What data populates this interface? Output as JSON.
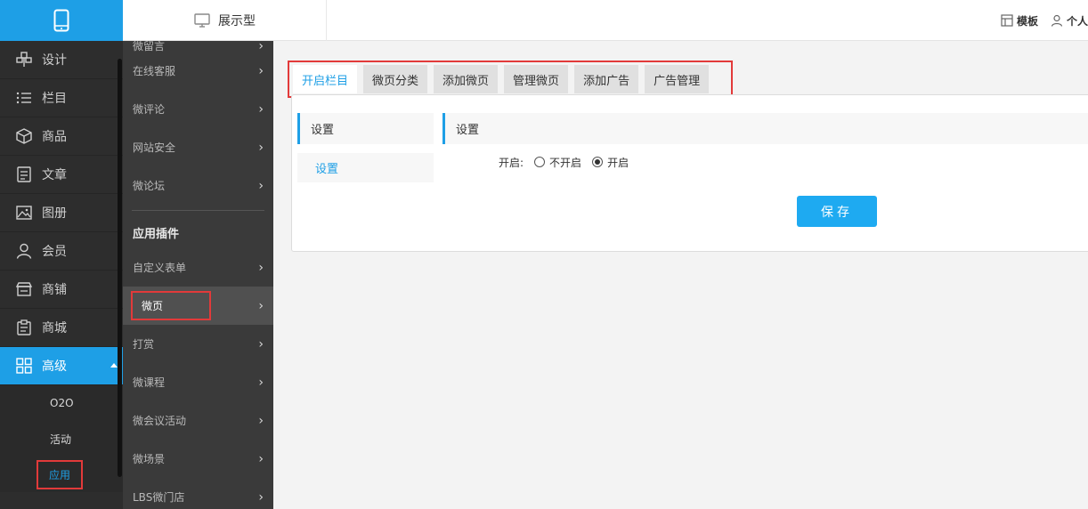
{
  "header": {
    "view_mode": "展示型",
    "template_label": "模板",
    "personal_label": "个人"
  },
  "main_nav": {
    "items": [
      {
        "label": "设计",
        "icon": "design-icon"
      },
      {
        "label": "栏目",
        "icon": "list-icon"
      },
      {
        "label": "商品",
        "icon": "box-icon"
      },
      {
        "label": "文章",
        "icon": "document-icon"
      },
      {
        "label": "图册",
        "icon": "image-icon"
      },
      {
        "label": "会员",
        "icon": "user-icon"
      },
      {
        "label": "商铺",
        "icon": "store-icon"
      },
      {
        "label": "商城",
        "icon": "clipboard-icon"
      },
      {
        "label": "高级",
        "icon": "grid-icon",
        "active": true
      }
    ],
    "sub_items": [
      {
        "label": "O2O"
      },
      {
        "label": "活动"
      },
      {
        "label": "应用",
        "active": true
      }
    ]
  },
  "sub_nav": {
    "items_top": [
      "微留言",
      "在线客服",
      "微评论",
      "网站安全",
      "微论坛"
    ],
    "section_title": "应用插件",
    "items_bottom": [
      "自定义表单",
      "微页",
      "打赏",
      "微课程",
      "微会议活动",
      "微场景",
      "LBS微门店"
    ],
    "active": "微页"
  },
  "tabs": [
    "开启栏目",
    "微页分类",
    "添加微页",
    "管理微页",
    "添加广告",
    "广告管理"
  ],
  "side_menu": {
    "title": "设置",
    "link": "设置"
  },
  "settings": {
    "title": "设置",
    "field_label": "开启:",
    "option_off": "不开启",
    "option_on": "开启",
    "selected": "开启",
    "save_label": "保存"
  },
  "colors": {
    "accent": "#1e9fe6",
    "highlight_border": "#e23a3a",
    "nav_bg": "#2d2d2d",
    "subnav_bg": "#3a3a3a"
  }
}
